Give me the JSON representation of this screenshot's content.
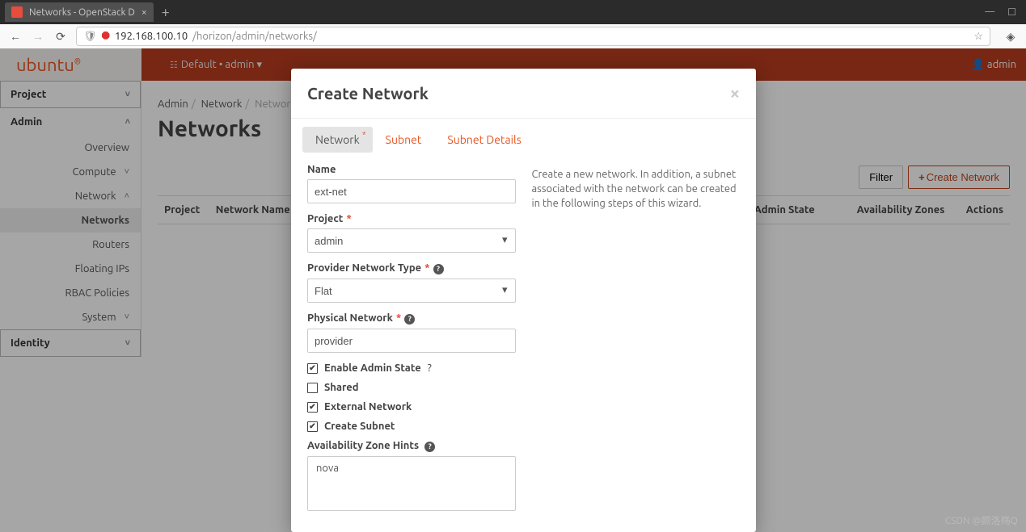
{
  "browser": {
    "tab_title": "Networks - OpenStack D",
    "url_host": "192.168.100.10",
    "url_path": "/horizon/admin/networks/"
  },
  "topbar": {
    "brand": "ubuntu",
    "domain_label": "Default • admin",
    "user_label": "admin"
  },
  "sidebar": {
    "groups": [
      {
        "label": "Project",
        "expanded": false
      },
      {
        "label": "Admin",
        "expanded": true
      },
      {
        "label": "Identity",
        "expanded": false
      }
    ],
    "admin_items": [
      {
        "label": "Overview",
        "caret": false
      },
      {
        "label": "Compute",
        "caret": true
      },
      {
        "label": "Network",
        "caret": true,
        "open": true
      },
      {
        "label": "System",
        "caret": true
      }
    ],
    "network_children": [
      {
        "label": "Networks",
        "active": true
      },
      {
        "label": "Routers"
      },
      {
        "label": "Floating IPs"
      },
      {
        "label": "RBAC Policies"
      }
    ]
  },
  "breadcrumb": [
    "Admin",
    "Network",
    "Networks"
  ],
  "page_title": "Networks",
  "toolbar": {
    "filter_label": "Filter",
    "create_label": "Create Network"
  },
  "table": {
    "columns": [
      "Project",
      "Network Name",
      "Admin State",
      "Availability Zones",
      "Actions"
    ]
  },
  "modal": {
    "title": "Create Network",
    "tabs": [
      "Network",
      "Subnet",
      "Subnet Details"
    ],
    "active_tab": 0,
    "description": "Create a new network. In addition, a subnet associated with the network can be created in the following steps of this wizard.",
    "form": {
      "name_label": "Name",
      "name_value": "ext-net",
      "project_label": "Project",
      "project_value": "admin",
      "provider_type_label": "Provider Network Type",
      "provider_type_value": "Flat",
      "physical_label": "Physical Network",
      "physical_value": "provider",
      "enable_admin_label": "Enable Admin State",
      "enable_admin_checked": true,
      "shared_label": "Shared",
      "shared_checked": false,
      "external_label": "External Network",
      "external_checked": true,
      "create_subnet_label": "Create Subnet",
      "create_subnet_checked": true,
      "az_hints_label": "Availability Zone Hints",
      "az_hints_option": "nova"
    }
  },
  "watermark": "CSDN @颜洛殇Q"
}
